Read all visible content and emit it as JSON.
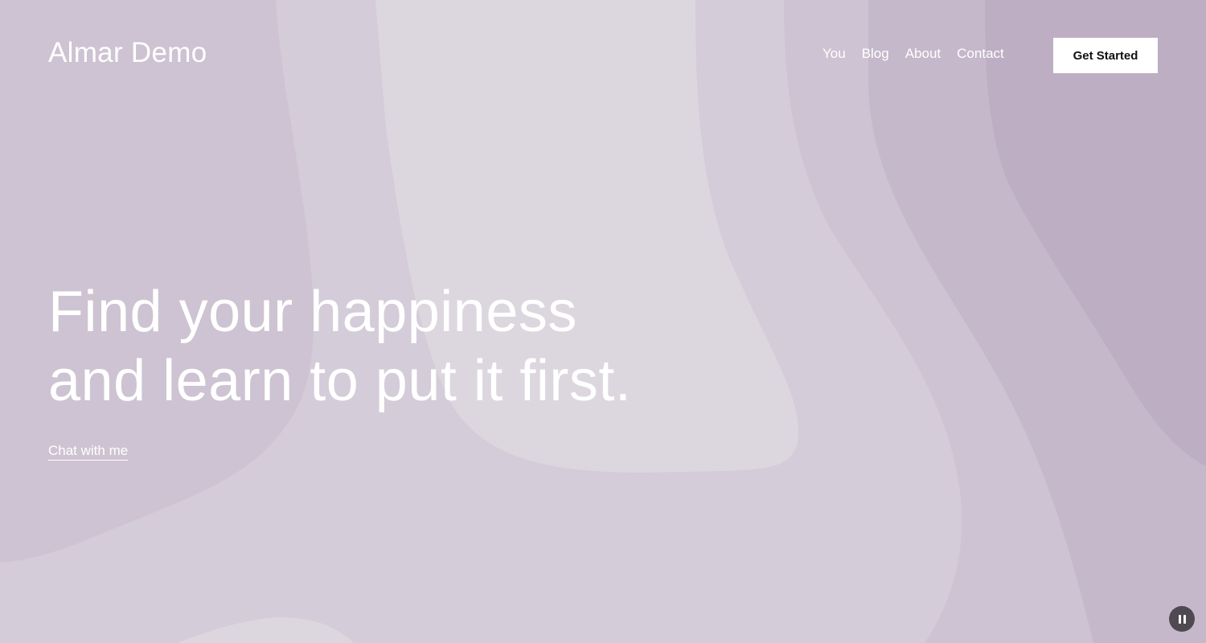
{
  "header": {
    "logo": "Almar Demo",
    "nav": [
      "You",
      "Blog",
      "About",
      "Contact"
    ],
    "cta_label": "Get Started"
  },
  "hero": {
    "line1": "Find your happiness",
    "line2": "and learn to put it first.",
    "link_label": "Chat with me"
  },
  "controls": {
    "pause_icon": "pause-icon"
  },
  "colors": {
    "background": "#d4ccd9",
    "light_band": "#dcd7df",
    "mid_band": "#cec3d2",
    "darker_band": "#c6b8cb",
    "darkest_band": "#bdaec3",
    "button_bg": "#ffffff"
  }
}
